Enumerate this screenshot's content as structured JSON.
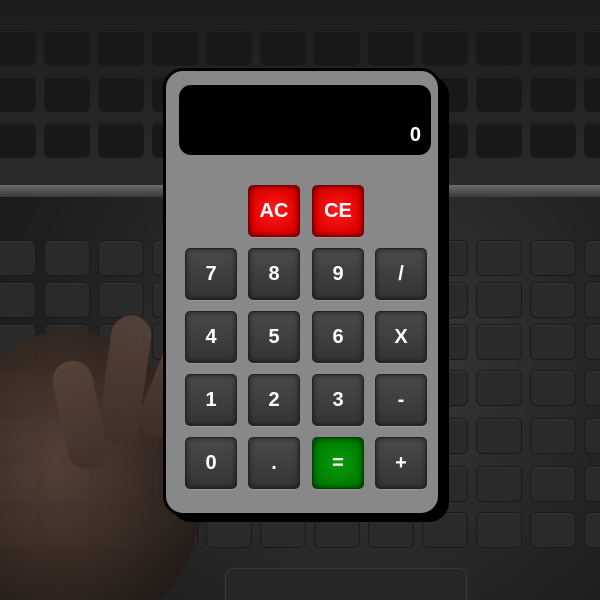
{
  "display": {
    "value": "0"
  },
  "controls": {
    "all_clear": "AC",
    "clear_entry": "CE"
  },
  "keypad": {
    "seven": "7",
    "eight": "8",
    "nine": "9",
    "divide": "/",
    "four": "4",
    "five": "5",
    "six": "6",
    "multiply": "X",
    "one": "1",
    "two": "2",
    "three": "3",
    "subtract": "-",
    "zero": "0",
    "decimal": ".",
    "equals": "=",
    "add": "+"
  },
  "colors": {
    "body": "#888888",
    "clear_buttons": "#e00000",
    "equals_button": "#008000",
    "number_buttons": "#3c3c3c",
    "display_background": "#000000",
    "display_text": "#ffffff"
  }
}
